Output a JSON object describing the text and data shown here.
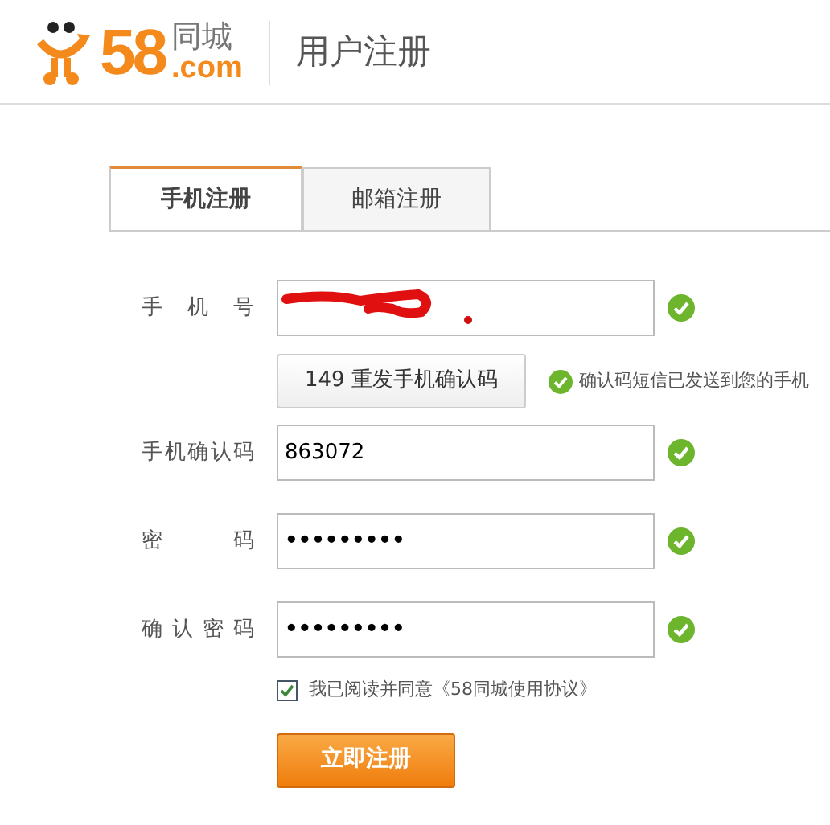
{
  "header": {
    "logo": {
      "number": "58",
      "name": "同城",
      "domain": ".com"
    },
    "title": "用户注册"
  },
  "tabs": [
    {
      "label": "手机注册",
      "selected": true
    },
    {
      "label": "邮箱注册",
      "selected": false
    }
  ],
  "fields": [
    {
      "label": "手机号",
      "redacted": true,
      "valid": true
    },
    {
      "label": "手机确认码",
      "value": "863072",
      "redacted": false,
      "valid": true
    },
    {
      "label": "密码",
      "value": "•••••••••",
      "redacted": false,
      "valid": true
    },
    {
      "label": "确认密码",
      "value": "•••••••••",
      "redacted": false,
      "valid": true
    }
  ],
  "resend": {
    "button": "149 重发手机确认码",
    "message": "确认码短信已发送到您的手机"
  },
  "agreement": {
    "checked": true,
    "text": "我已阅读并同意《58同城使用协议》"
  },
  "submit": "立即注册"
}
